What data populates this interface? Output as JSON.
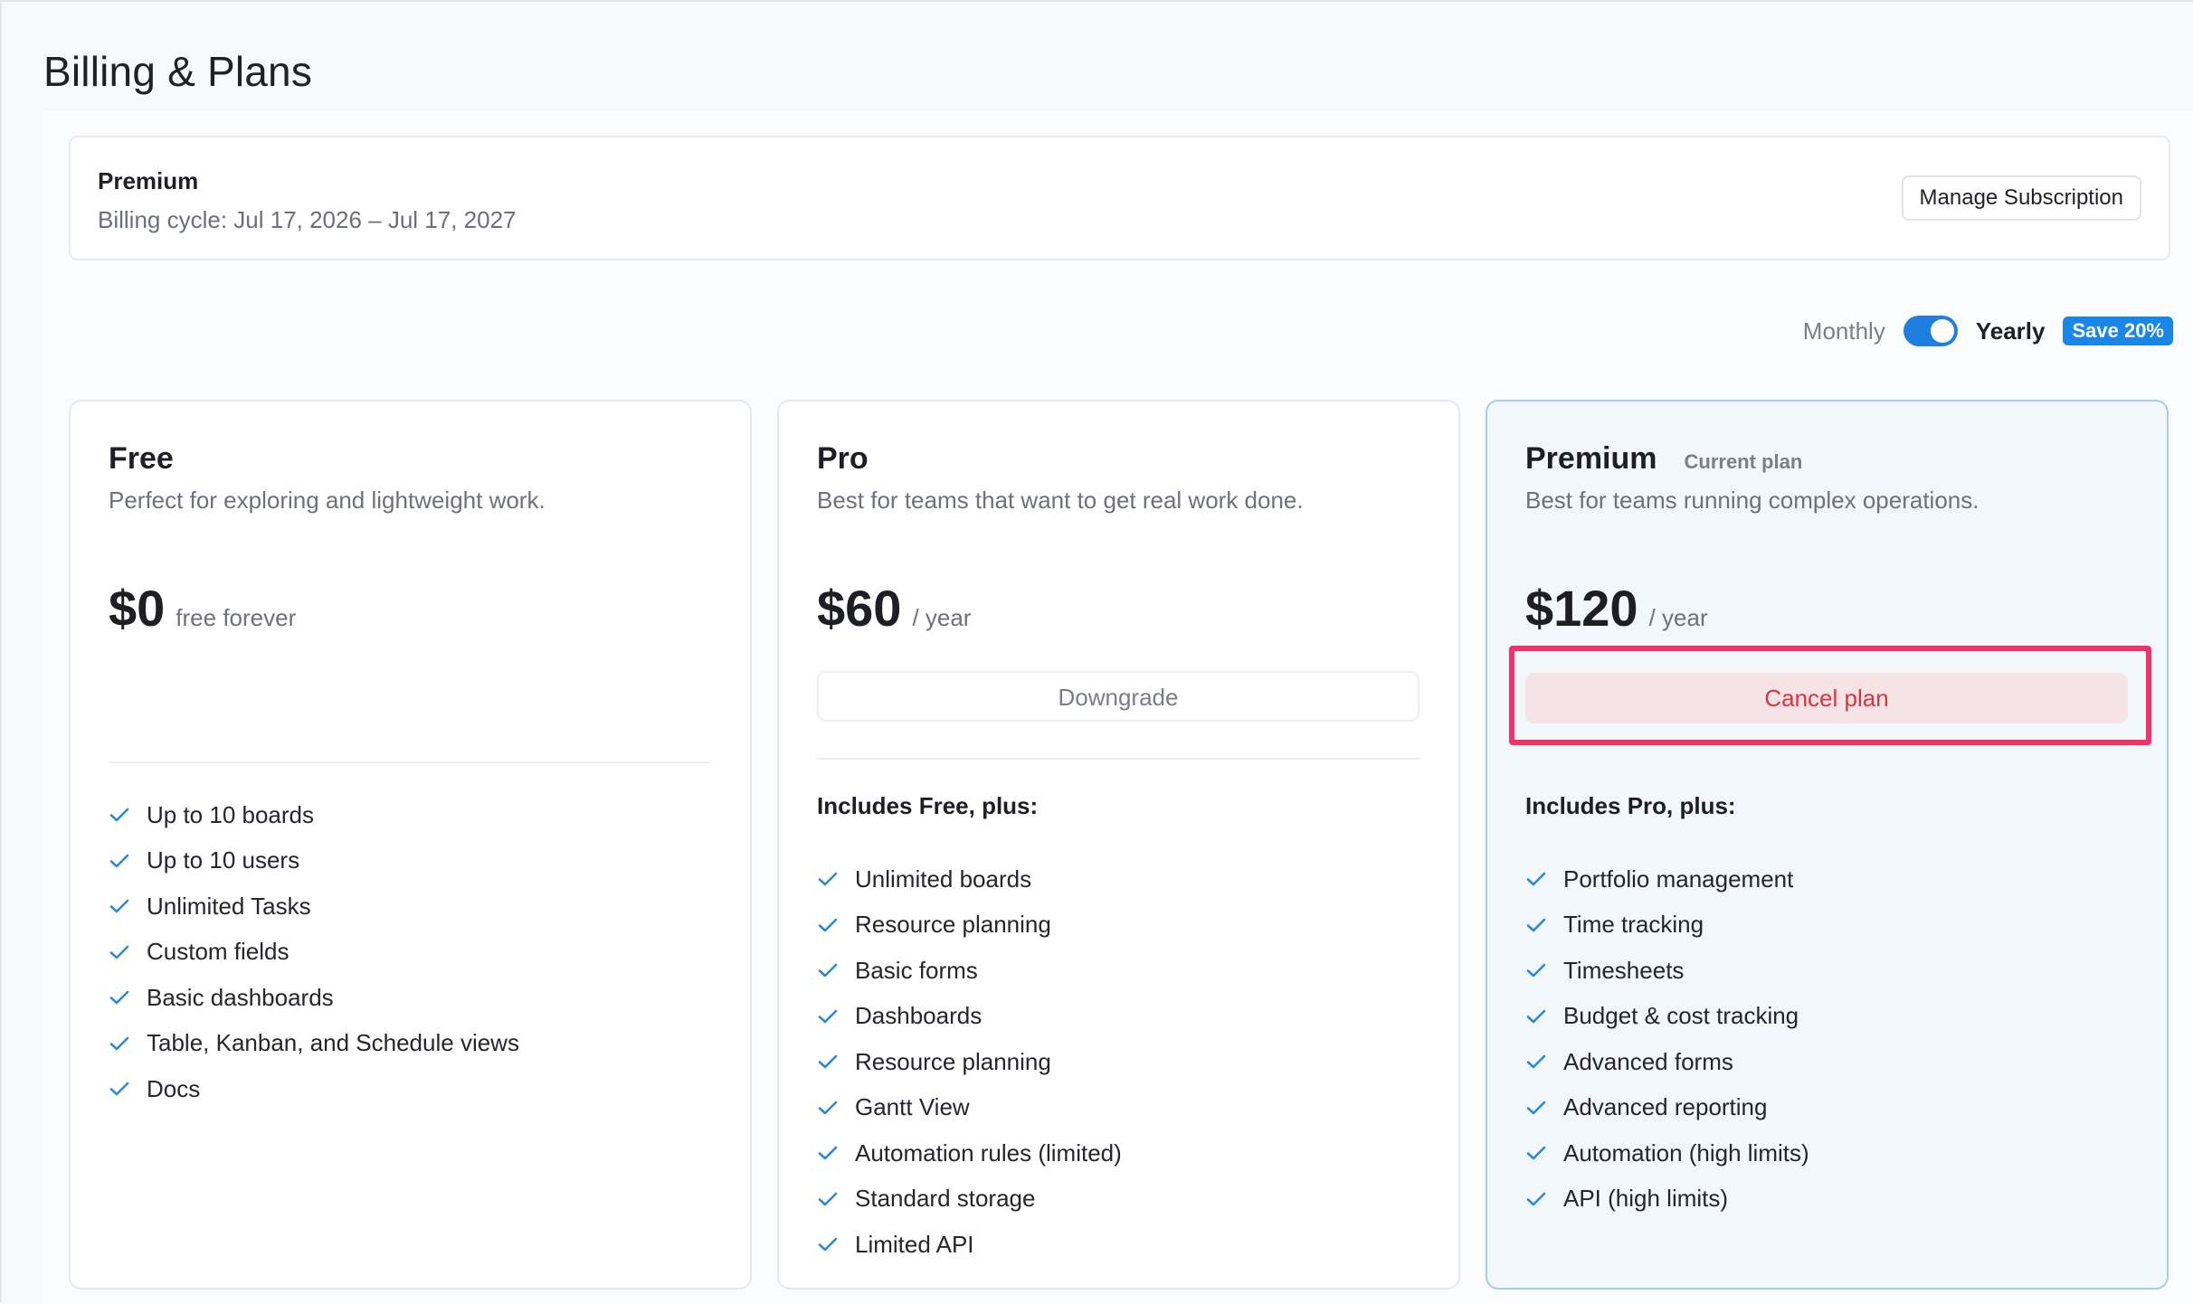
{
  "page": {
    "title": "Billing & Plans"
  },
  "subscription": {
    "plan_name": "Premium",
    "billing_cycle": "Billing cycle: Jul 17, 2026 – Jul 17, 2027",
    "manage_label": "Manage Subscription"
  },
  "billing_toggle": {
    "monthly_label": "Monthly",
    "yearly_label": "Yearly",
    "selected": "Yearly",
    "save_badge": "Save 20%",
    "accent_color": "#1f7fe0"
  },
  "plans": [
    {
      "name": "Free",
      "description": "Perfect for exploring and lightweight work.",
      "price": "$0",
      "price_unit": "free forever",
      "features": [
        "Up to 10 boards",
        "Up to 10 users",
        "Unlimited Tasks",
        "Custom fields",
        "Basic dashboards",
        "Table, Kanban, and Schedule views",
        "Docs"
      ]
    },
    {
      "name": "Pro",
      "description": "Best for teams that want to get real work done.",
      "price": "$60",
      "price_unit": "/ year",
      "action_label": "Downgrade",
      "features_heading": "Includes Free, plus:",
      "features": [
        "Unlimited boards",
        "Resource planning",
        "Basic forms",
        "Dashboards",
        "Resource planning",
        "Gantt View",
        "Automation rules (limited)",
        "Standard storage",
        "Limited API"
      ]
    },
    {
      "name": "Premium",
      "current_tag": "Current plan",
      "description": "Best for teams running complex operations.",
      "price": "$120",
      "price_unit": "/ year",
      "action_label": "Cancel plan",
      "features_heading": "Includes Pro, plus:",
      "features": [
        "Portfolio management",
        "Time tracking",
        "Timesheets",
        "Budget & cost tracking",
        "Advanced forms",
        "Advanced reporting",
        "Automation (high limits)",
        "API (high limits)"
      ]
    }
  ],
  "icons": {
    "feature_check": "check-icon",
    "check_color": "#2a8ad6"
  },
  "highlight_color": "#f2336a"
}
